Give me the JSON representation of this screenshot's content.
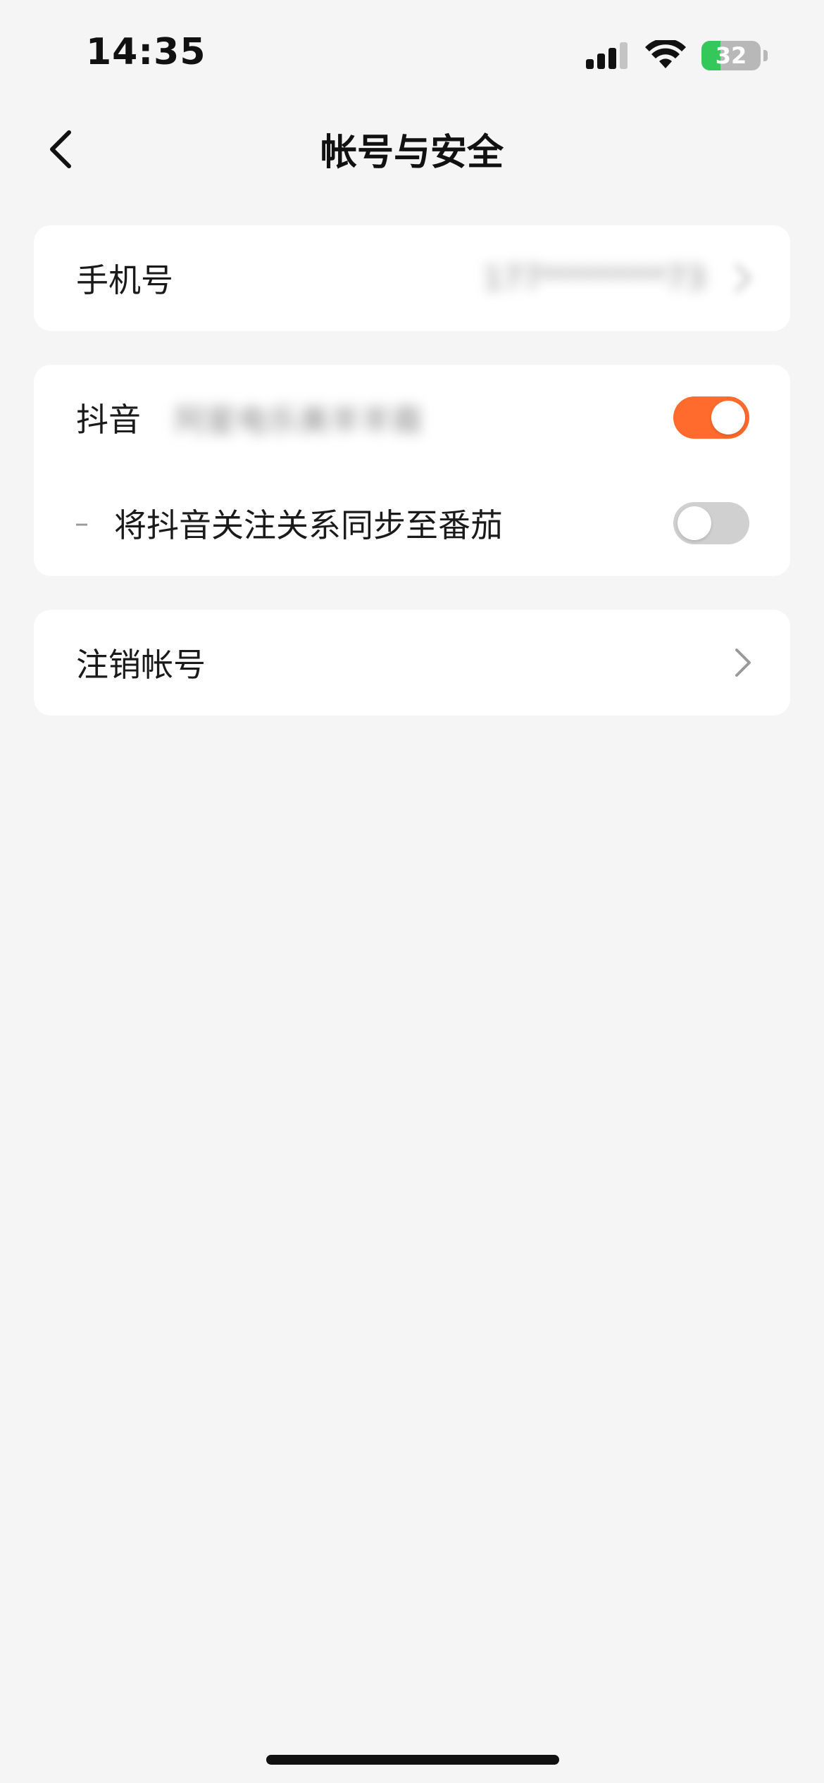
{
  "status_bar": {
    "time": "14:35",
    "battery_level": "32",
    "battery_fraction": 0.32,
    "battery_color": "#34c759"
  },
  "nav": {
    "title": "帐号与安全",
    "back_icon": "chevron-left-icon"
  },
  "rows": {
    "phone": {
      "label": "手机号",
      "value_blurred": "177********73"
    },
    "douyin": {
      "label": "抖音",
      "value_blurred": "阿星电乐美羊羊裔",
      "toggle_on": true,
      "toggle_color": "#ff6b2c"
    },
    "sync_follow": {
      "label": "将抖音关注关系同步至番茄",
      "prefix": "–",
      "toggle_on": false,
      "toggle_color": "#d0d0d0"
    },
    "deactivate": {
      "label": "注销帐号"
    }
  }
}
